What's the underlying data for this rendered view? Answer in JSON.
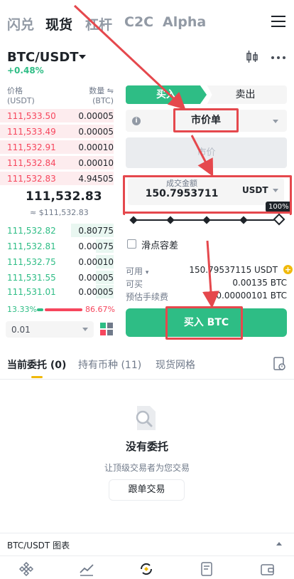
{
  "top_nav": {
    "tabs": [
      "闪兑",
      "现货",
      "杠杆",
      "C2C",
      "Alpha"
    ],
    "active": "现货"
  },
  "market": {
    "pair": "BTC/USDT",
    "change": "+0.48%"
  },
  "orderbook": {
    "price_header": "价格",
    "price_unit": "(USDT)",
    "qty_header": "数量 ⇋",
    "qty_unit": "(BTC)",
    "asks": [
      {
        "price": "111,533.50",
        "qty": "0.00005"
      },
      {
        "price": "111,533.49",
        "qty": "0.00005"
      },
      {
        "price": "111,532.91",
        "qty": "0.00010"
      },
      {
        "price": "111,532.84",
        "qty": "0.00010"
      },
      {
        "price": "111,532.83",
        "qty": "4.94505"
      }
    ],
    "last_price": "111,532.83",
    "last_price_usd": "≈ $111,532.83",
    "bids": [
      {
        "price": "111,532.82",
        "qty": "0.80775"
      },
      {
        "price": "111,532.81",
        "qty": "0.00075"
      },
      {
        "price": "111,532.75",
        "qty": "0.00010"
      },
      {
        "price": "111,531.55",
        "qty": "0.00005"
      },
      {
        "price": "111,531.01",
        "qty": "0.00005"
      }
    ],
    "buy_ratio": "13.33%",
    "sell_ratio": "86.67%",
    "buy_ratio_value": 13.33,
    "depth": "0.01"
  },
  "order_form": {
    "buy_tab": "买入",
    "sell_tab": "卖出",
    "order_type": "市价单",
    "price_placeholder": "市价",
    "amount_label": "成交金额",
    "amount_value": "150.7953711",
    "unit": "USDT",
    "slider_percent": "100%",
    "slider_value": 100,
    "slippage_label": "滑点容差",
    "available_label": "可用",
    "available_value": "150.79537115 USDT",
    "can_buy_label": "可买",
    "can_buy_value": "0.00135 BTC",
    "fee_label": "预估手续费",
    "fee_value": "0.00000101 BTC",
    "buy_button": "买入 BTC"
  },
  "orders_tabs": {
    "tabs": [
      "当前委托 (0)",
      "持有币种 (11)",
      "现货网格"
    ],
    "active": "当前委托 (0)"
  },
  "empty_state": {
    "title": "没有委托",
    "subtitle": "让顶级交易者为您交易",
    "button": "跟单交易"
  },
  "chart_bar": {
    "label": "BTC/USDT 图表"
  },
  "colors": {
    "green": "#2ebd85",
    "red": "#f6465d",
    "yellow": "#f0b90b",
    "annotation": "#e5484d"
  }
}
